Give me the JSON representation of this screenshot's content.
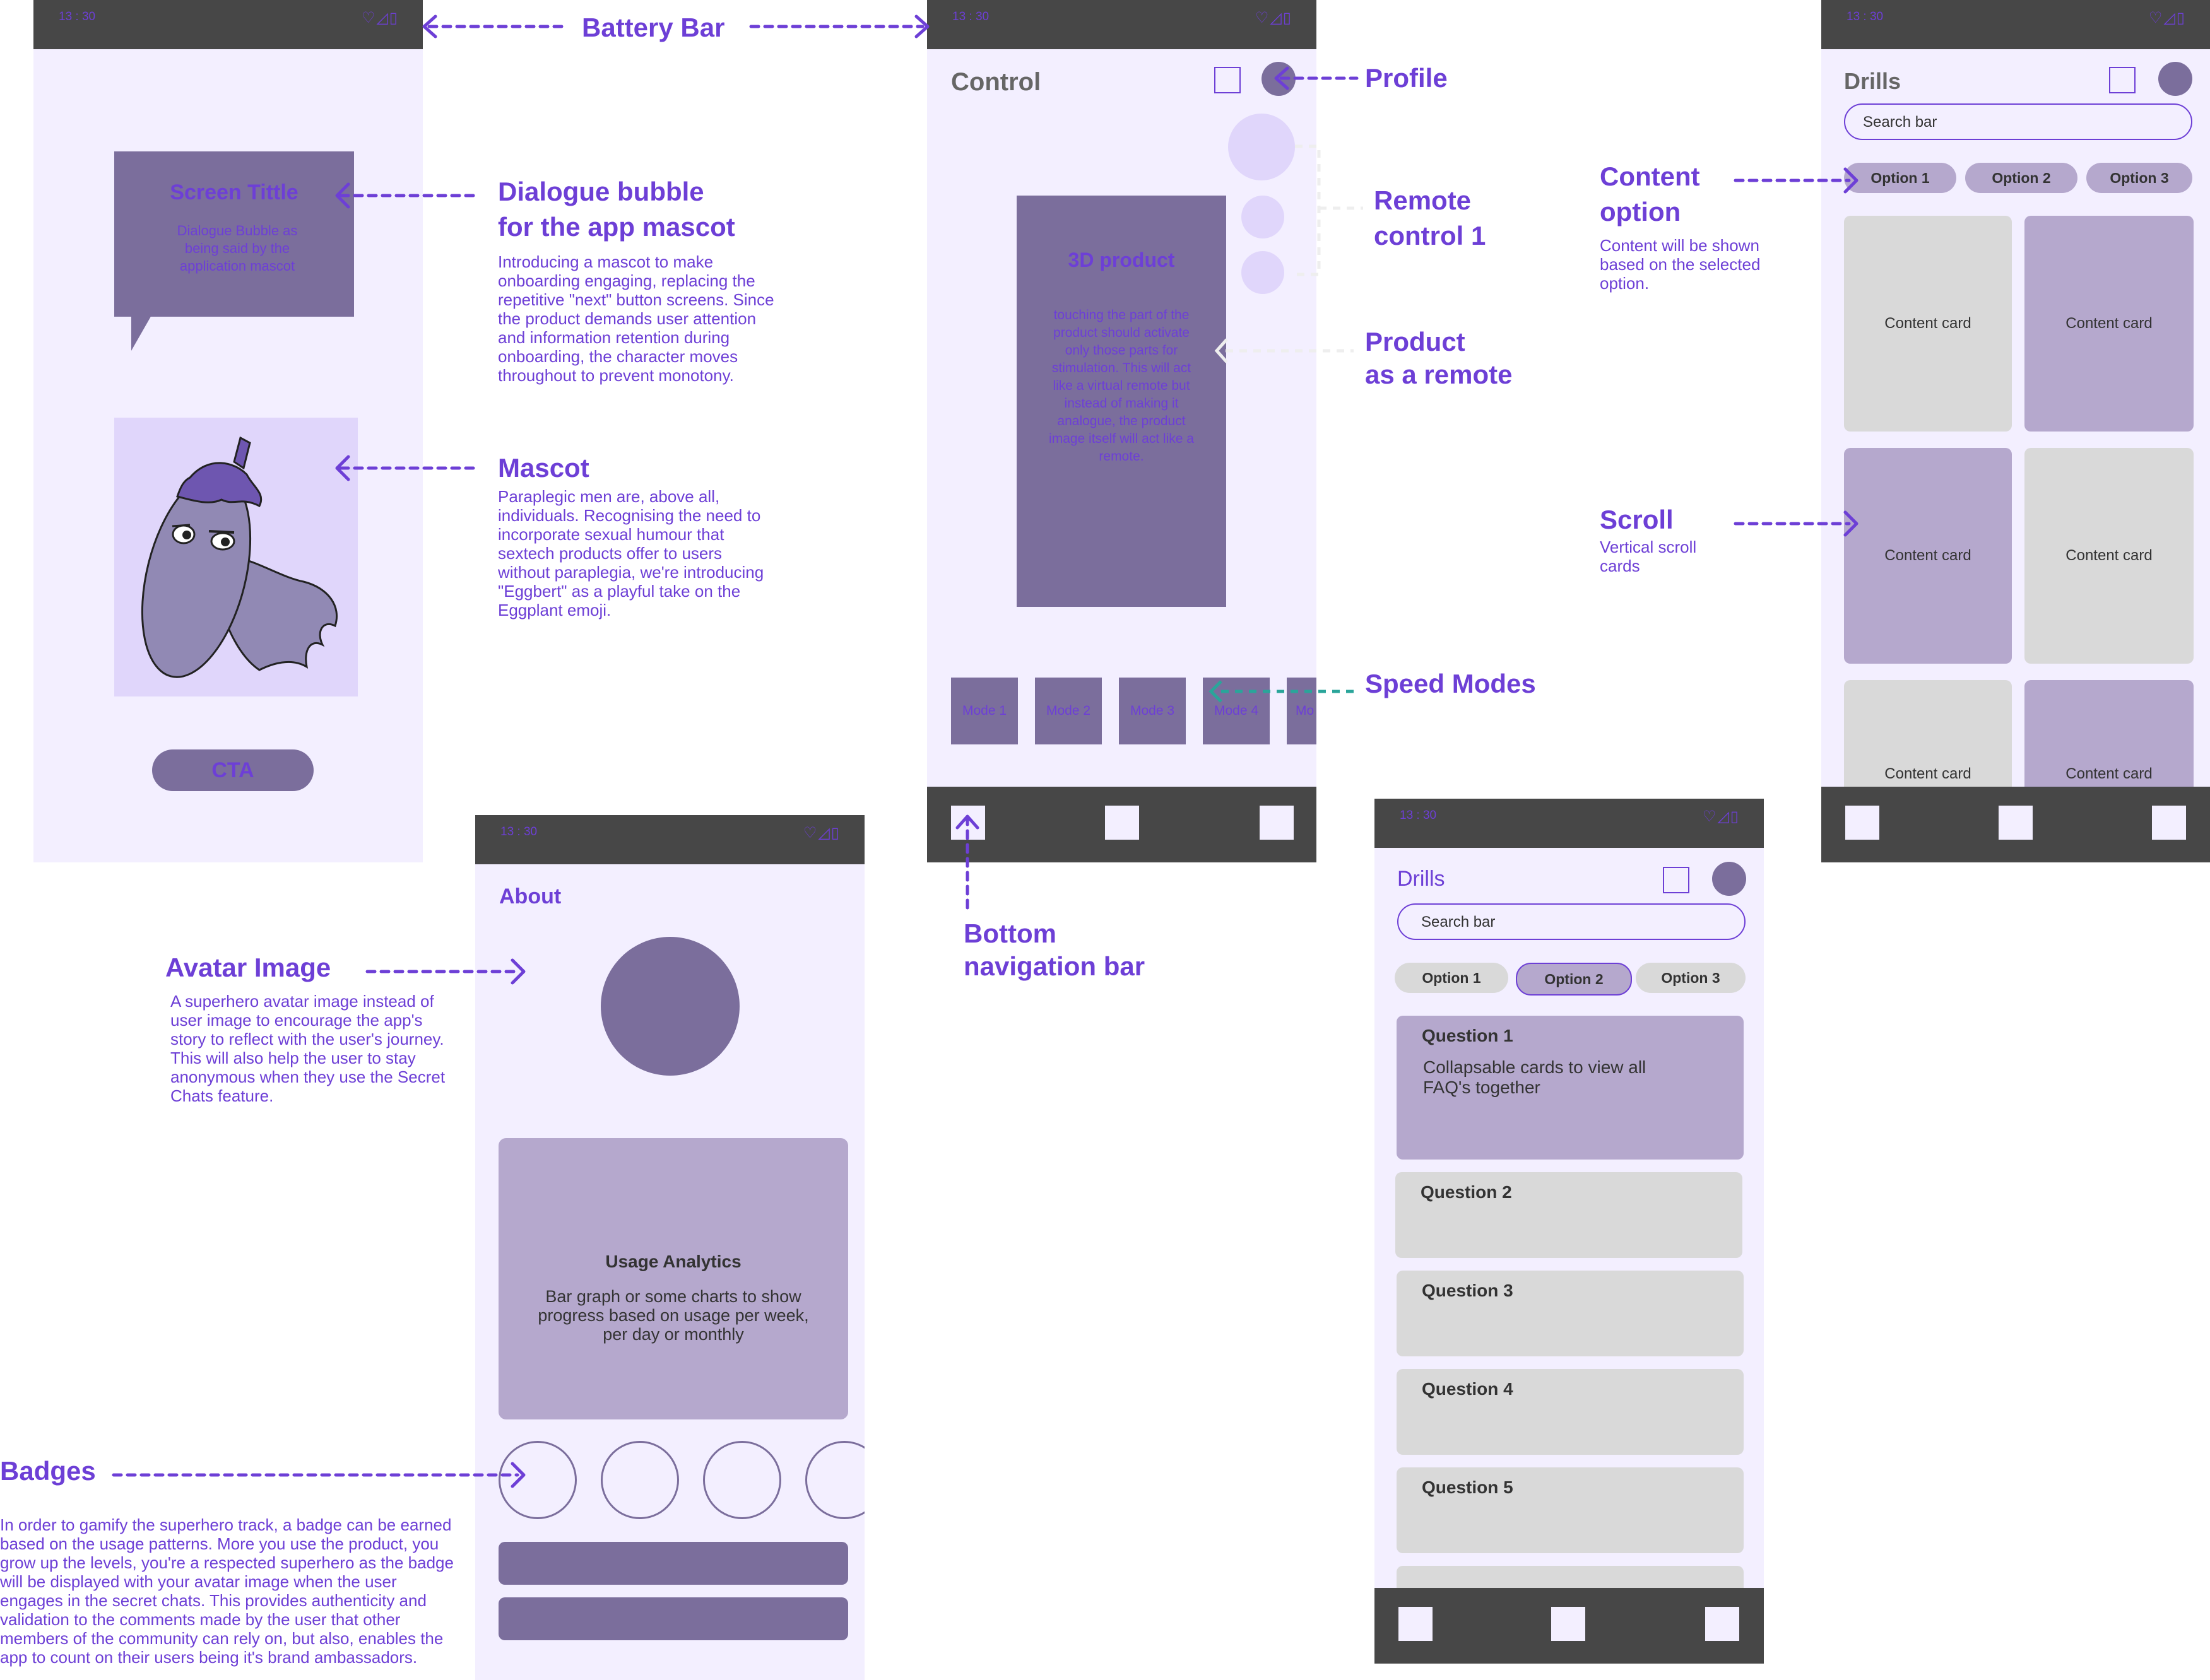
{
  "status": {
    "time": "13 : 30",
    "icons": "♡◿▯"
  },
  "onboarding": {
    "bubble_title": "Screen Tittle",
    "bubble_text": "Dialogue Bubble as being said by the application mascot",
    "cta": "CTA"
  },
  "control": {
    "title": "Control",
    "product_title": "3D product",
    "product_text": "touching the part of the product should activate only those parts for stimulation. This will act like a virtual remote but instead of making it analogue, the product image itself will act like a remote.",
    "modes": [
      "Mode 1",
      "Mode 2",
      "Mode 3",
      "Mode 4",
      "Mo"
    ]
  },
  "drills_grid": {
    "title": "Drills",
    "search_placeholder": "Search bar",
    "options": [
      "Option 1",
      "Option 2",
      "Option 3"
    ],
    "card_label": "Content card"
  },
  "about": {
    "title": "About",
    "analytics_title": "Usage Analytics",
    "analytics_text": "Bar graph or some charts to show progress based on usage per week, per day or monthly"
  },
  "drills_faq": {
    "title": "Drills",
    "search_placeholder": "Search bar",
    "options": [
      "Option 1",
      "Option 2",
      "Option 3"
    ],
    "questions": [
      "Question 1",
      "Question 2",
      "Question 3",
      "Question 4",
      "Question 5"
    ],
    "q1_text": "Collapsable cards to view all FAQ's together"
  },
  "annotations": {
    "battery_bar": "Battery Bar",
    "profile": "Profile",
    "dialogue_title_1": "Dialogue bubble",
    "dialogue_title_2": "for the app mascot",
    "dialogue_body": "Introducing a mascot to make onboarding engaging, replacing the repetitive \"next\" button screens. Since the product demands user attention and information retention during onboarding, the character moves throughout to prevent monotony.",
    "mascot_title": "Mascot",
    "mascot_body": "Paraplegic men are, above all, individuals. Recognising the need to incorporate sexual humour that sextech products offer to users without paraplegia, we're introducing \"Eggbert\" as a playful take on the Eggplant emoji.",
    "remote_title_1": "Remote",
    "remote_title_2": "control 1",
    "product_remote_1": "Product",
    "product_remote_2": "as a remote",
    "speed_modes": "Speed Modes",
    "bottom_nav_1": "Bottom",
    "bottom_nav_2": "navigation bar",
    "content_option_1": "Content",
    "content_option_2": "option",
    "content_option_body": "Content will be shown based on the selected option.",
    "scroll_title": "Scroll",
    "scroll_body": "Vertical scroll cards",
    "avatar_title": "Avatar Image",
    "avatar_body": "A superhero avatar image instead of user image to encourage the app's story to reflect with the user's journey. This will also help the user to stay anonymous when they use the Secret Chats feature.",
    "badges_title": "Badges",
    "badges_body": "In order to gamify the superhero track, a badge can be earned based on the usage patterns. More you use the product, you grow up the levels, you're a respected superhero as the badge will be displayed with your avatar image when the user engages in the secret chats. This provides authenticity and validation to the comments made by the user that other members of the community can rely on, but also, enables the app to count on their users being it's brand ambassadors."
  },
  "colors": {
    "accent": "#6d3fd6",
    "dark_bar": "#474747",
    "screen_bg": "#f3efff",
    "muted_purple": "#7b6e9c",
    "light_purple": "#b5a8cd",
    "grey_card": "#d9d9d9",
    "teal_arrow": "#2aa59a"
  }
}
